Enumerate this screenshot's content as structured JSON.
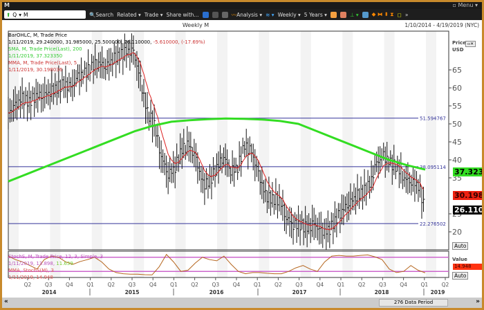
{
  "window": {
    "title": "M",
    "menu": "Menu"
  },
  "toolbar": {
    "symbol_type": "Q",
    "symbol": "M",
    "items": [
      "Search",
      "Related",
      "Trade",
      "Share with...",
      "Analysis",
      "Weekly",
      "5 Years"
    ]
  },
  "chart": {
    "title": "Weekly M",
    "date_range": "1/10/2014 - 4/19/2019 (NYC)",
    "axis_title": "Price",
    "axis_unit": "USD",
    "auto": "Auto",
    "period": "276 Data Period",
    "legend": [
      "BarOHLC, M, Trade Price",
      "1/11/2019, 29.240000, 31.985000, 25.500000, 26.110000, ",
      "-5.610000, (-17.69%)",
      "SMA, M, Trade Price(Last),  200",
      "1/11/2019, 37.323350",
      "MMA, M, Trade Price(Last),  5",
      "1/11/2019, 30.198036"
    ],
    "price_ticks": [
      65,
      60,
      55,
      50,
      45,
      40,
      35,
      25,
      20
    ],
    "hlines": [
      {
        "value": 51.594767,
        "label": "51.594767"
      },
      {
        "value": 38.095114,
        "label": "38.095114"
      },
      {
        "value": 22.276502,
        "label": "22.276502"
      }
    ],
    "tags": {
      "sma": "37.32335",
      "mma": "30.1980",
      "last": "26.1100"
    },
    "colors": {
      "sma": "#33dd22",
      "mma": "#dd2222",
      "bars": "#111111",
      "hline": "#333399",
      "stoch": "#cc66cc"
    },
    "monthly_close": [
      53,
      55,
      57,
      56,
      58,
      58,
      59,
      60,
      61,
      60,
      63,
      64,
      66,
      67,
      66,
      68,
      69,
      70,
      70,
      62,
      53,
      50,
      41,
      36,
      38,
      43,
      44,
      40,
      33,
      34,
      38,
      41,
      37,
      38,
      44,
      42,
      36,
      30,
      29,
      29,
      24,
      22,
      22,
      21,
      22,
      20,
      20,
      23,
      26,
      28,
      30,
      31,
      33,
      39,
      41,
      39,
      38,
      35,
      34,
      33,
      26
    ],
    "sma200": [
      34,
      36,
      38,
      40,
      42,
      44,
      46,
      48,
      49.5,
      50.6,
      51,
      51.3,
      51.5,
      51.4,
      51.2,
      50.8,
      50,
      48,
      46,
      44,
      42,
      40,
      38.5,
      37.3
    ]
  },
  "stoch": {
    "legend": [
      "StochS, M, Trade Price,  12, 3, Simple, 3",
      "1/11/2019, 13.898, ",
      "11.639",
      "MMA, StochS(M),  3",
      "1/11/2019, 14.948"
    ],
    "axis_title": "Value",
    "tag": "14.948",
    "levels": [
      80,
      20
    ],
    "values": [
      85,
      70,
      60,
      45,
      30,
      70,
      85,
      80,
      60,
      50,
      62,
      70,
      80,
      60,
      30,
      15,
      10,
      8,
      8,
      6,
      5,
      40,
      92,
      60,
      20,
      25,
      55,
      80,
      70,
      65,
      85,
      50,
      20,
      10,
      15,
      15,
      12,
      10,
      10,
      20,
      35,
      45,
      30,
      20,
      60,
      85,
      88,
      85,
      85,
      88,
      90,
      82,
      70,
      30,
      15,
      20,
      45,
      25,
      14
    ]
  },
  "xaxis": {
    "quarters": [
      "Q2",
      "Q3",
      "Q4",
      "Q1",
      "Q2",
      "Q3",
      "Q4",
      "Q1",
      "Q2",
      "Q3",
      "Q4",
      "Q1",
      "Q2",
      "Q3",
      "Q4",
      "Q1",
      "Q2",
      "Q3",
      "Q4",
      "Q1",
      "Q2"
    ],
    "years": [
      "2014",
      "2015",
      "2016",
      "2017",
      "2018",
      "2019"
    ]
  }
}
